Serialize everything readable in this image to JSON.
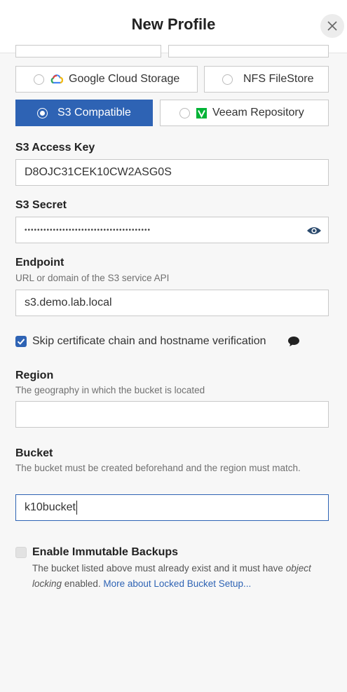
{
  "dialog": {
    "title": "New Profile"
  },
  "storage_options": {
    "gcs_label": "Google Cloud Storage",
    "nfs_label": "NFS FileStore",
    "s3_label": "S3 Compatible",
    "veeam_label": "Veeam Repository",
    "selected": "S3 Compatible"
  },
  "access_key": {
    "label": "S3 Access Key",
    "value": "D8OJC31CEK10CW2ASG0S"
  },
  "secret": {
    "label": "S3 Secret",
    "value": "••••••••••••••••••••••••••••••••••••••••"
  },
  "endpoint": {
    "label": "Endpoint",
    "help": "URL or domain of the S3 service API",
    "value": "s3.demo.lab.local"
  },
  "skip_verification": {
    "label": "Skip certificate chain and hostname verification",
    "checked": true
  },
  "region": {
    "label": "Region",
    "help": "The geography in which the bucket is located",
    "value": ""
  },
  "bucket": {
    "label": "Bucket",
    "help": "The bucket must be created beforehand and the region must match.",
    "value": "k10bucket"
  },
  "immutable": {
    "label": "Enable Immutable Backups",
    "checked": false,
    "help_pre": "The bucket listed above must already exist and it must have",
    "help_em": "object locking",
    "help_post": "enabled.",
    "link": "More about Locked Bucket Setup..."
  },
  "icons": {
    "close": "close-icon",
    "gcs": "google-cloud-icon",
    "veeam": "veeam-icon",
    "reveal": "eye-icon",
    "tooltip": "speech-bubble-icon",
    "check": "checkmark-icon"
  },
  "colors": {
    "accent": "#2e63b4",
    "veeam_green": "#00b336"
  }
}
